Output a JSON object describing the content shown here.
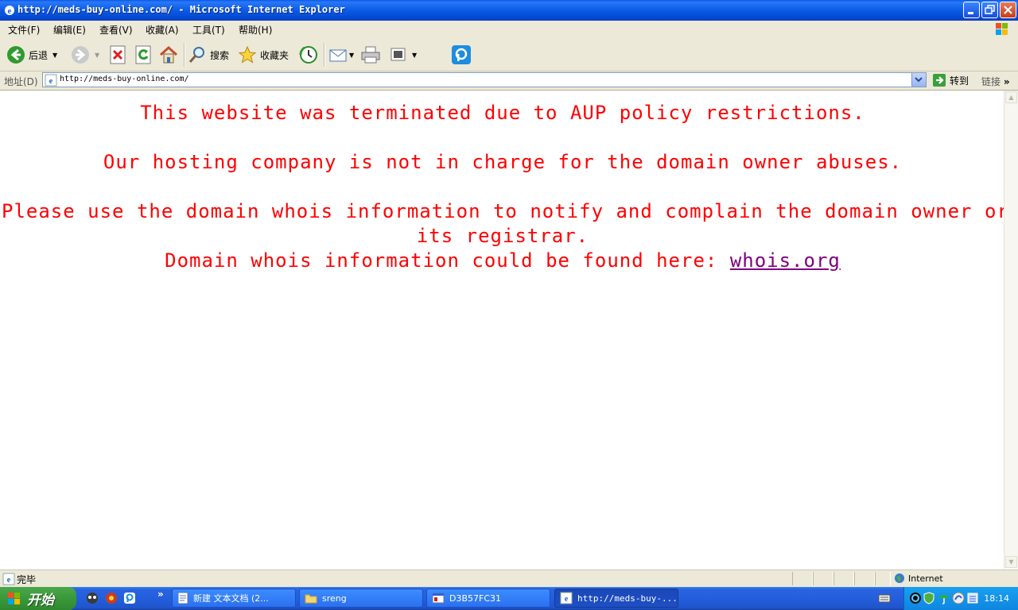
{
  "window": {
    "title": "http://meds-buy-online.com/ - Microsoft Internet Explorer"
  },
  "menu": {
    "items": [
      "文件(F)",
      "编辑(E)",
      "查看(V)",
      "收藏(A)",
      "工具(T)",
      "帮助(H)"
    ]
  },
  "toolbar": {
    "back_label": "后退",
    "search_label": "搜索",
    "favorites_label": "收藏夹"
  },
  "address": {
    "label": "地址(D)",
    "url": "http://meds-buy-online.com/",
    "go_label": "转到",
    "links_label": "链接"
  },
  "page": {
    "line1": "This website was terminated due to AUP policy restrictions.",
    "line2": "Our hosting company is not in charge for the domain owner abuses.",
    "line3a": "Please use the domain whois information to notify and complain the domain owner or",
    "line3b": "its registrar.",
    "line4_prefix": "Domain whois information could be found here: ",
    "line4_link": "whois.org",
    "text_color": "#ff0000",
    "link_color": "#800080"
  },
  "status": {
    "text": "完毕",
    "zone": "Internet"
  },
  "taskbar": {
    "start_label": "开始",
    "tasks": [
      "新建 文本文档 (2...",
      "sreng",
      "D3B57FC31",
      "http://meds-buy-..."
    ],
    "active_task": 3,
    "clock": "18:14"
  }
}
